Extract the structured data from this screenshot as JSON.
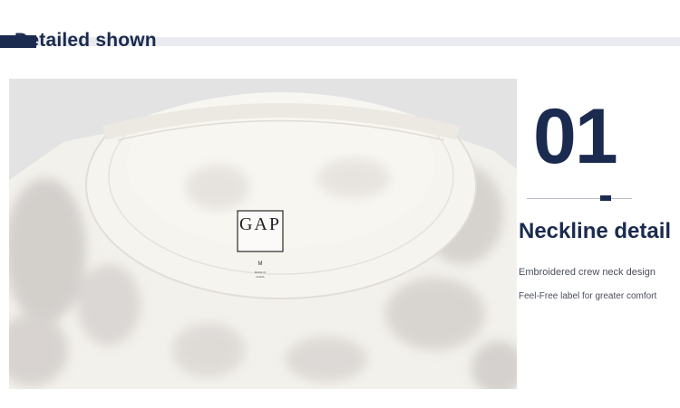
{
  "header": {
    "title": "Detailed shown"
  },
  "feature": {
    "number": "01",
    "heading": "Neckline detail",
    "lines": [
      "Embroidered crew neck design",
      "Feel-Free label for greater comfort"
    ]
  },
  "label": {
    "brand": "GAP",
    "size": "M",
    "origin_line1": "MADE IN",
    "origin_line2": "CHINA"
  },
  "colors": {
    "navy": "#1b2a4f",
    "band": "#e9ebee"
  }
}
